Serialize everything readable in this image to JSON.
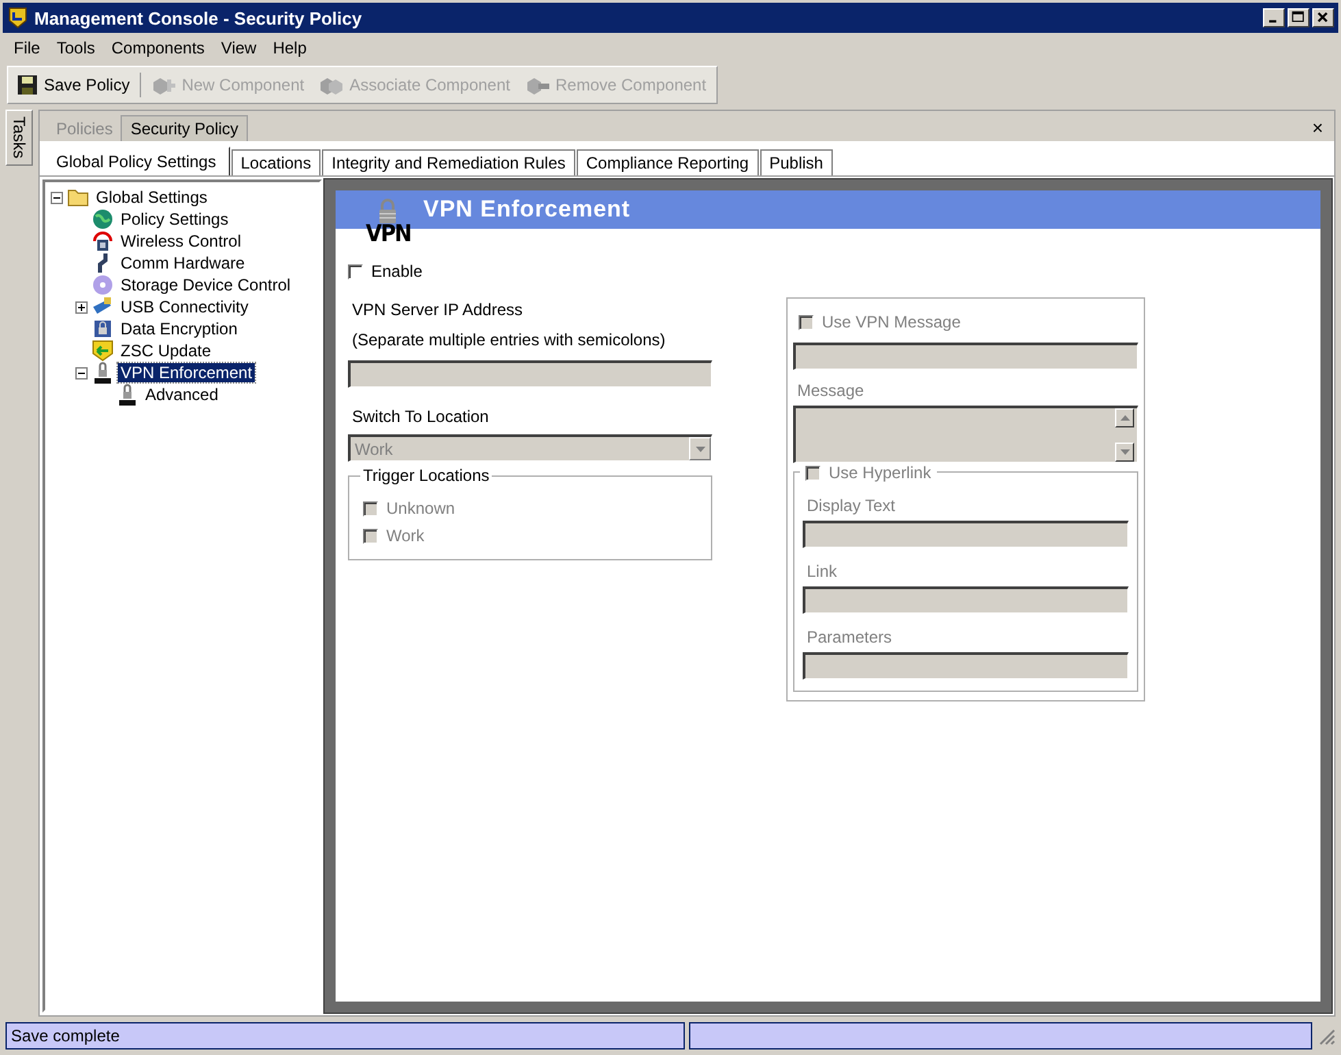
{
  "window": {
    "title": "Management Console - Security Policy"
  },
  "menu": [
    "File",
    "Tools",
    "Components",
    "View",
    "Help"
  ],
  "toolbar": [
    {
      "label": "Save Policy",
      "disabled": false
    },
    {
      "label": "New Component",
      "disabled": true
    },
    {
      "label": "Associate Component",
      "disabled": true
    },
    {
      "label": "Remove Component",
      "disabled": true
    }
  ],
  "side_tab": "Tasks",
  "document_tabs": [
    {
      "label": "Policies",
      "selected": false
    },
    {
      "label": "Security Policy",
      "selected": true
    }
  ],
  "close_glyph": "×",
  "tabs": [
    {
      "label": "Global Policy Settings",
      "selected": true
    },
    {
      "label": "Locations",
      "selected": false
    },
    {
      "label": "Integrity and Remediation Rules",
      "selected": false
    },
    {
      "label": "Compliance Reporting",
      "selected": false
    },
    {
      "label": "Publish",
      "selected": false
    }
  ],
  "tree": [
    {
      "label": "Global Settings",
      "expanded": true,
      "selected": false,
      "children": [
        {
          "label": "Policy Settings",
          "selected": false
        },
        {
          "label": "Wireless Control",
          "selected": false
        },
        {
          "label": "Comm Hardware",
          "selected": false
        },
        {
          "label": "Storage Device Control",
          "selected": false
        },
        {
          "label": "USB Connectivity",
          "expanded": false,
          "selected": false
        },
        {
          "label": "Data Encryption",
          "selected": false
        },
        {
          "label": "ZSC Update",
          "selected": false
        },
        {
          "label": "VPN Enforcement",
          "expanded": true,
          "selected": true,
          "children": [
            {
              "label": "Advanced",
              "selected": false
            }
          ]
        }
      ]
    }
  ],
  "panel": {
    "title": "VPN Enforcement",
    "logo": "VPN",
    "enable": {
      "label": "Enable",
      "checked": false
    },
    "server": {
      "label": "VPN Server IP Address",
      "hint": "(Separate multiple entries with semicolons)",
      "disabled": true
    },
    "switch_to": {
      "label": "Switch To Location",
      "value": "Work",
      "disabled": true
    },
    "trigger": {
      "title": "Trigger Locations",
      "items": [
        {
          "label": "Unknown",
          "checked": false,
          "disabled": true
        },
        {
          "label": "Work",
          "checked": false,
          "disabled": true
        }
      ]
    },
    "message": {
      "label": "Use VPN Message",
      "checked": false,
      "disabled": true,
      "message_label": "Message",
      "hyperlink": {
        "label": "Use Hyperlink",
        "checked": false,
        "disabled": true,
        "fields": [
          "Display Text",
          "Link",
          "Parameters"
        ]
      }
    }
  },
  "status_bar": {
    "text": "Save complete"
  }
}
